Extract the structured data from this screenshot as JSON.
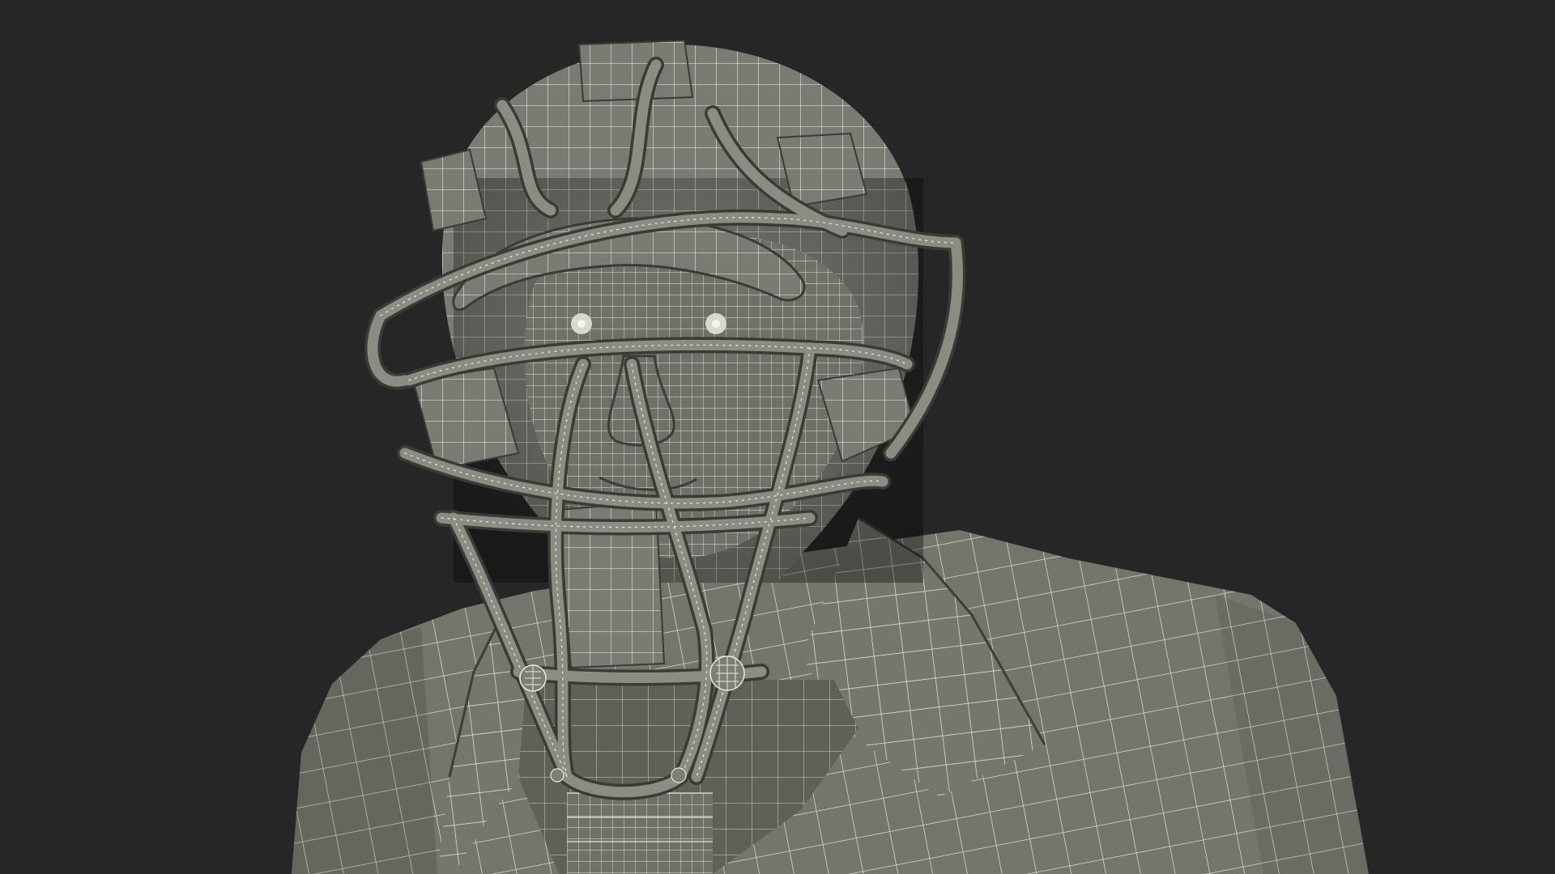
{
  "scene": {
    "subject": "umpire-wireframe-render",
    "background_color": "#262626",
    "mesh_fill_color": "#75766c",
    "mesh_shadow_color": "#5d5e56",
    "wire_color": "#e9e9df",
    "eye_color": "#d8d8cf",
    "icon": "wireframe-3d-model"
  }
}
